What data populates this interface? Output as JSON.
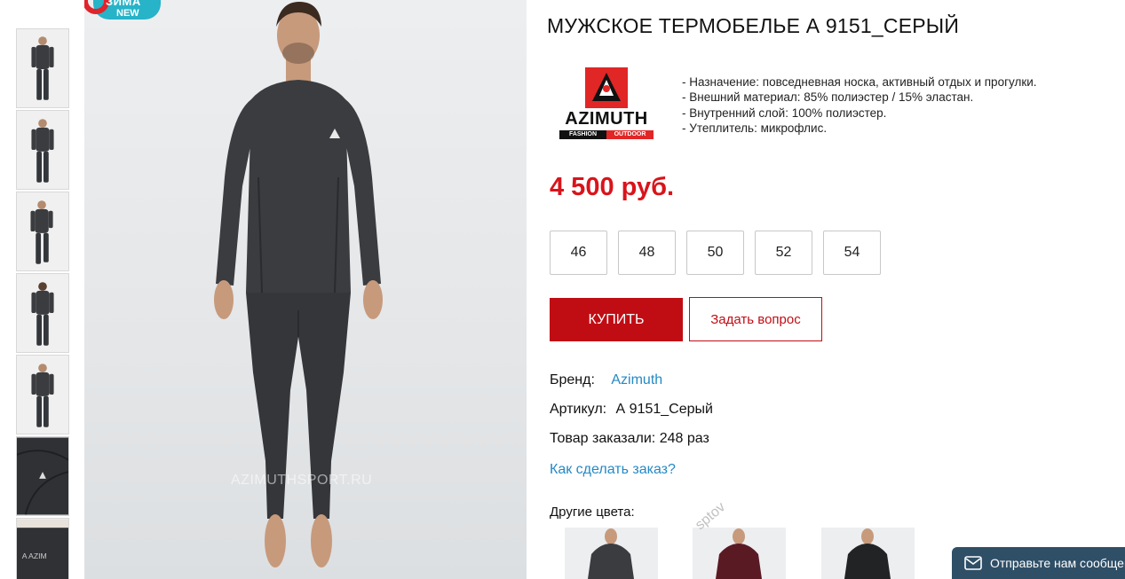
{
  "badge": {
    "line1": "ЗИМА",
    "line2": "NEW"
  },
  "gallery": {
    "thumbnails": [
      {
        "alt": "thumb-1"
      },
      {
        "alt": "thumb-2"
      },
      {
        "alt": "thumb-3"
      },
      {
        "alt": "thumb-4"
      },
      {
        "alt": "thumb-5"
      },
      {
        "alt": "thumb-6"
      },
      {
        "alt": "thumb-7"
      }
    ],
    "watermark": "AZIMUTHSPORT.RU"
  },
  "product": {
    "title": "МУЖСКОЕ ТЕРМОБЕЛЬЕ А 9151_СЕРЫЙ",
    "brand_logo": {
      "name": "AZIMUTH",
      "tag_left": "FASHION",
      "tag_right": "OUTDOOR"
    },
    "features": [
      "- Назначение: повседневная носка, активный отдых и прогулки.",
      "- Внешний материал: 85% полиэстер / 15% эластан.",
      "- Внутренний слой: 100% полиэстер.",
      "- Утеплитель: микрофлис."
    ],
    "price": "4 500 руб.",
    "sizes": [
      "46",
      "48",
      "50",
      "52",
      "54"
    ],
    "buy_label": "КУПИТЬ",
    "ask_label": "Задать вопрос",
    "brand_label": "Бренд:",
    "brand_value": "Azimuth",
    "article_label": "Артикул:",
    "article_value": "А 9151_Серый",
    "ordered_text": "Товар заказали: 248 раз",
    "how_to_order": "Как сделать заказ?",
    "other_colors_label": "Другие цвета:"
  },
  "colors": {
    "accent": "#d9141b",
    "button": "#c00d14",
    "link": "#2489c5",
    "garment_grey": "#3a3c3f",
    "garment_burgundy": "#5a1a24",
    "garment_black": "#222325",
    "chat_bg": "#2f4f67"
  },
  "chat": {
    "label": "Отправьте нам сообщение",
    "icon": "envelope-icon"
  },
  "side_watermark": "sptov"
}
